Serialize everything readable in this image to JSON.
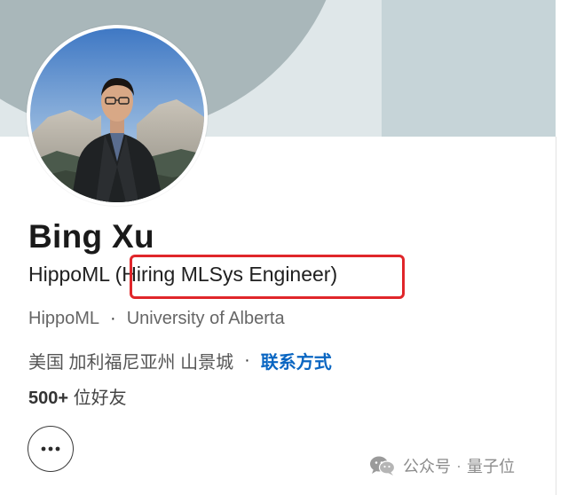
{
  "profile": {
    "name": "Bing Xu",
    "headline_company": "HippoML",
    "headline_tagline": "(Hiring MLSys Engineer)",
    "organization": "HippoML",
    "school": "University of Alberta",
    "location": "美国 加利福尼亚州 山景城",
    "contact_label": "联系方式",
    "friends_count": "500+",
    "friends_label": "位好友",
    "separator": "·"
  },
  "watermark": {
    "source": "公众号",
    "separator": "·",
    "account": "量子位"
  },
  "colors": {
    "link": "#0a66c2",
    "highlight": "#e0262a",
    "banner_dark": "#a9b7ba",
    "banner_light": "#dfe7e9",
    "banner_panel": "#c6d4d8"
  },
  "icons": {
    "more": "more-horizontal-icon",
    "watermark": "wechat-icon"
  }
}
